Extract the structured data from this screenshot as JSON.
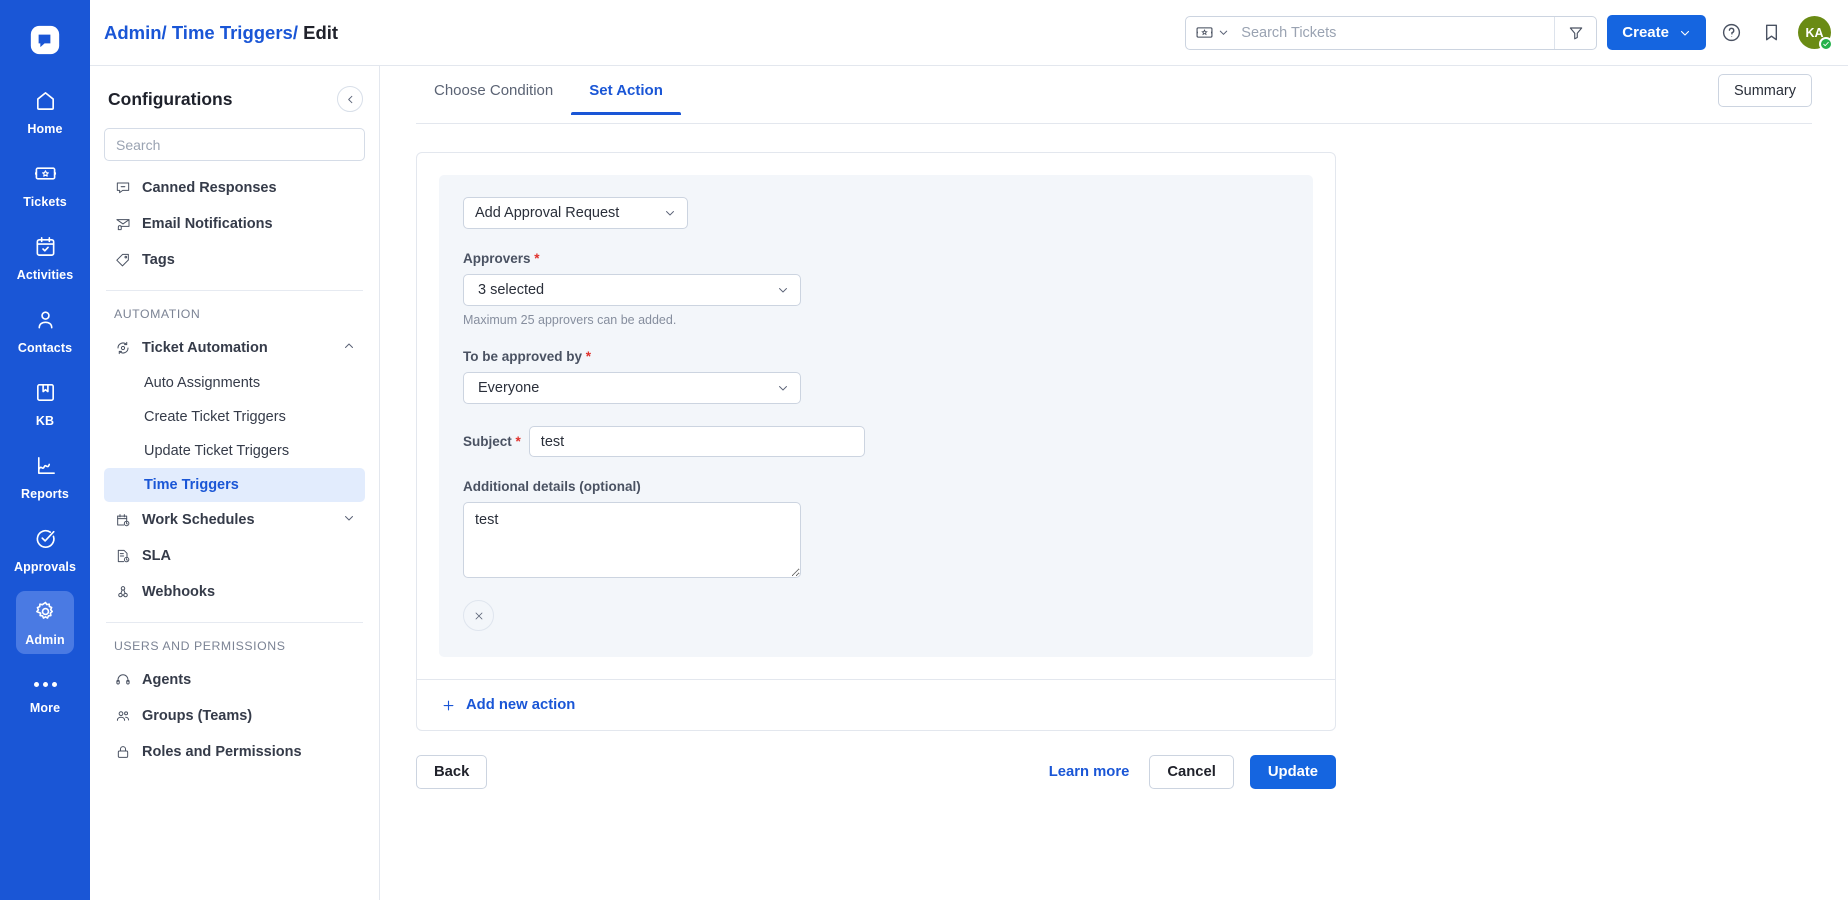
{
  "rail": {
    "logo_icon": "app-logo-icon",
    "items": [
      {
        "label": "Home",
        "icon": "home-icon",
        "active": false
      },
      {
        "label": "Tickets",
        "icon": "ticket-icon",
        "active": false
      },
      {
        "label": "Activities",
        "icon": "calendar-icon",
        "active": false
      },
      {
        "label": "Contacts",
        "icon": "person-icon",
        "active": false
      },
      {
        "label": "KB",
        "icon": "book-icon",
        "active": false
      },
      {
        "label": "Reports",
        "icon": "chart-icon",
        "active": false
      },
      {
        "label": "Approvals",
        "icon": "check-circle-icon",
        "active": false
      },
      {
        "label": "Admin",
        "icon": "gear-icon",
        "active": true
      },
      {
        "label": "More",
        "icon": "ellipsis-icon",
        "active": false
      }
    ]
  },
  "header": {
    "breadcrumb": {
      "part1": "Admin/",
      "part2": " Time Triggers/",
      "part3": " Edit"
    },
    "search": {
      "placeholder": "Search Tickets",
      "value": "",
      "scope_icon": "ticket-icon",
      "filter_icon": "filter-icon"
    },
    "create_label": "Create",
    "help_icon": "question-circle-icon",
    "bookmark_icon": "bookmark-icon",
    "avatar_initials": "KA"
  },
  "sidebar": {
    "title": "Configurations",
    "collapse_icon": "chevron-left-icon",
    "search_placeholder": "Search",
    "search_value": "",
    "top_items": [
      {
        "label": "Canned Responses",
        "icon": "canned-response-icon"
      },
      {
        "label": "Email Notifications",
        "icon": "email-bell-icon"
      },
      {
        "label": "Tags",
        "icon": "tag-icon"
      }
    ],
    "automation_section": "AUTOMATION",
    "ticket_automation": {
      "label": "Ticket Automation",
      "icon": "automation-icon",
      "expanded": true
    },
    "automation_subitems": [
      {
        "label": "Auto Assignments",
        "active": false
      },
      {
        "label": "Create Ticket Triggers",
        "active": false
      },
      {
        "label": "Update Ticket Triggers",
        "active": false
      },
      {
        "label": "Time Triggers",
        "active": true
      }
    ],
    "automation_items": [
      {
        "label": "Work Schedules",
        "icon": "schedule-icon",
        "has_chevron": true
      },
      {
        "label": "SLA",
        "icon": "sla-icon",
        "has_chevron": false
      },
      {
        "label": "Webhooks",
        "icon": "webhook-icon",
        "has_chevron": false
      }
    ],
    "users_section": "USERS AND PERMISSIONS",
    "users_items": [
      {
        "label": "Agents",
        "icon": "headset-icon"
      },
      {
        "label": "Groups (Teams)",
        "icon": "group-icon"
      },
      {
        "label": "Roles and Permissions",
        "icon": "lock-icon"
      }
    ]
  },
  "main": {
    "tabs": [
      {
        "label": "Choose Condition",
        "active": false
      },
      {
        "label": "Set Action",
        "active": true
      }
    ],
    "summary_label": "Summary",
    "action": {
      "type_value": "Add Approval Request",
      "approvers_label": "Approvers",
      "approvers_value": "3 selected",
      "approvers_hint": "Maximum 25 approvers can be added.",
      "approved_by_label": "To be approved by",
      "approved_by_value": "Everyone",
      "subject_label": "Subject",
      "subject_value": "test",
      "details_label": "Additional details (optional)",
      "details_value": "test",
      "remove_icon": "close-icon",
      "required_marker": "*"
    },
    "add_action_label": "Add new action",
    "add_action_icon": "plus-icon",
    "footer": {
      "back_label": "Back",
      "learn_more_label": "Learn more",
      "cancel_label": "Cancel",
      "update_label": "Update"
    }
  },
  "colors": {
    "brand_blue": "#1a56d6",
    "rail_blue": "#1a56d6",
    "active_item_bg": "#e2ecfd",
    "required_red": "#e0312b",
    "avatar_green": "#6a8b14",
    "status_green": "#24b24b"
  }
}
